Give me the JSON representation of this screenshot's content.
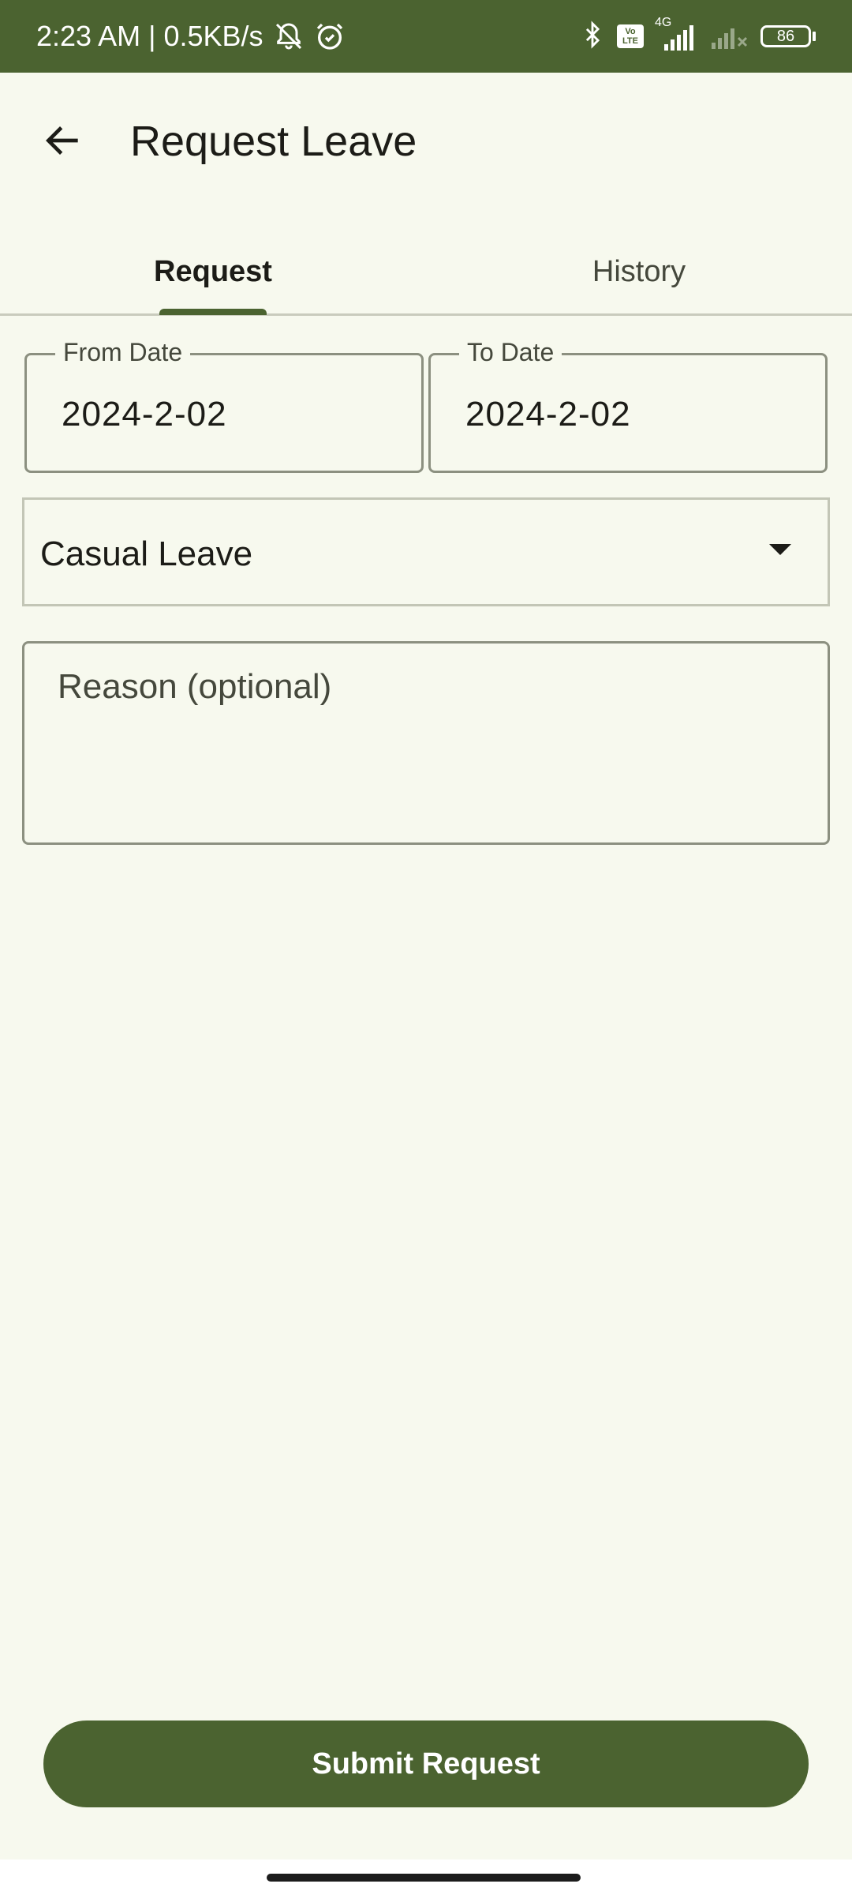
{
  "status_bar": {
    "time_and_speed": "2:23 AM | 0.5KB/s",
    "network_label": "4G",
    "volte_line1": "Vo",
    "volte_line2": "LTE",
    "battery_level": "86",
    "icons": [
      "mute-bell-icon",
      "alarm-icon",
      "bluetooth-icon",
      "volte-icon",
      "signal-icon",
      "signal-off-icon",
      "battery-icon"
    ]
  },
  "app_bar": {
    "title": "Request Leave",
    "back_icon": "arrow-left-icon"
  },
  "tabs": [
    {
      "label": "Request",
      "selected": true
    },
    {
      "label": "History",
      "selected": false
    }
  ],
  "form": {
    "from_date": {
      "label": "From Date",
      "value": "2024-2-02"
    },
    "to_date": {
      "label": "To Date",
      "value": "2024-2-02"
    },
    "leave_type": {
      "value": "Casual Leave"
    },
    "reason": {
      "placeholder": "Reason (optional)",
      "value": ""
    }
  },
  "submit": {
    "label": "Submit Request"
  },
  "colors": {
    "primary": "#4b6330",
    "background": "#f7f9ee",
    "outline": "#8c9080"
  }
}
